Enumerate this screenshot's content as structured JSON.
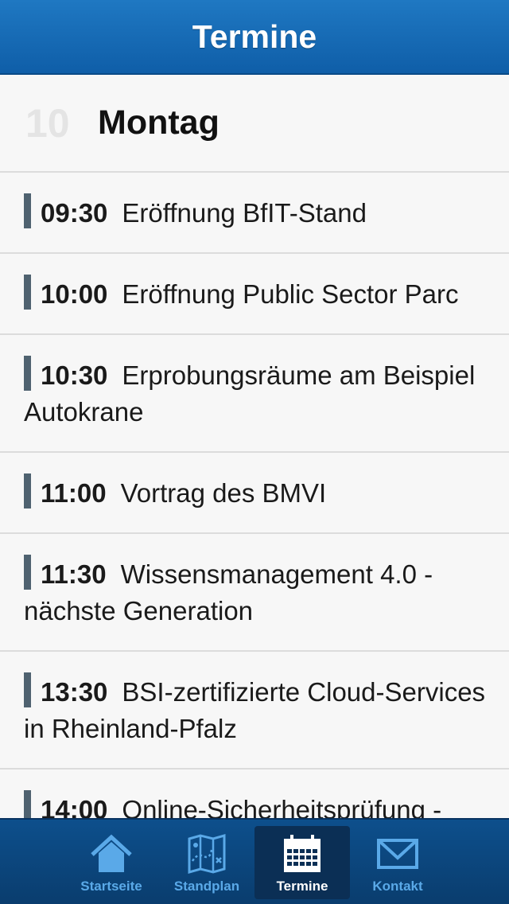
{
  "header": {
    "title": "Termine"
  },
  "day": {
    "number": "10",
    "name": "Montag"
  },
  "events": [
    {
      "time": "09:30",
      "title": "Eröffnung BfIT-Stand"
    },
    {
      "time": "10:00",
      "title": "Eröffnung Public Sector Parc"
    },
    {
      "time": "10:30",
      "title": "Erprobungsräume am Beispiel Autokrane"
    },
    {
      "time": "11:00",
      "title": "Vortrag des BMVI"
    },
    {
      "time": "11:30",
      "title": "Wissensmanagement 4.0 - nächste Generation"
    },
    {
      "time": "13:30",
      "title": "BSI-zertifizierte Cloud-Services in Rheinland-Pfalz"
    },
    {
      "time": "14:00",
      "title": "Online-Sicherheitsprüfung -"
    }
  ],
  "tabs": [
    {
      "label": "Startseite",
      "icon": "home-icon"
    },
    {
      "label": "Standplan",
      "icon": "map-icon"
    },
    {
      "label": "Termine",
      "icon": "calendar-icon",
      "active": true
    },
    {
      "label": "Kontakt",
      "icon": "mail-icon"
    }
  ],
  "colors": {
    "navbar": "#1565b0",
    "tabbar": "#0d4f8c",
    "accent_bar": "#4f6270",
    "tab_label": "#5aa9e8"
  }
}
